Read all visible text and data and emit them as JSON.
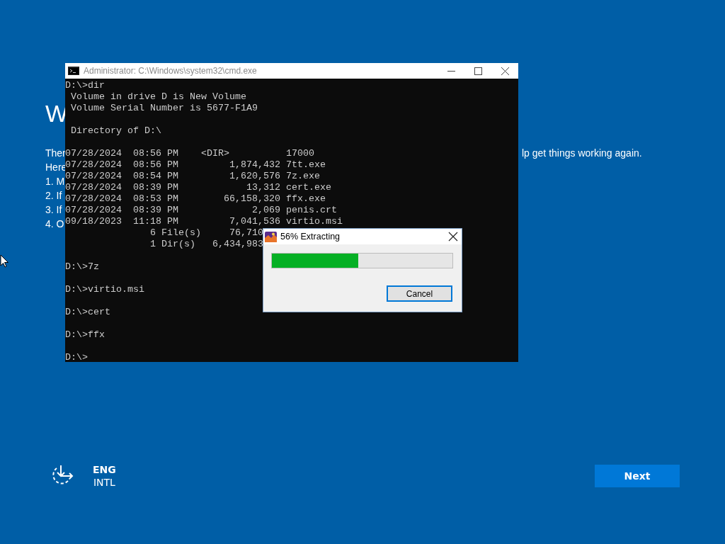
{
  "background_page": {
    "heading": "W",
    "lines": [
      "Ther",
      "Here",
      "1. M",
      "2. If",
      "3. If",
      "4. O"
    ],
    "line_end": "lp get things working again."
  },
  "cmd_window": {
    "title": "Administrator: C:\\Windows\\system32\\cmd.exe",
    "blocks": [
      [
        "D:\\>dir",
        " Volume in drive D is New Volume",
        " Volume Serial Number is 5677-F1A9"
      ],
      [
        " Directory of D:\\"
      ],
      [
        "07/28/2024  08:56 PM    <DIR>          17000",
        "07/28/2024  08:56 PM         1,874,432 7tt.exe",
        "07/28/2024  08:54 PM         1,620,576 7z.exe",
        "07/28/2024  08:39 PM            13,312 cert.exe",
        "07/28/2024  08:53 PM        66,158,320 ffx.exe",
        "07/28/2024  08:39 PM             2,069 penis.crt",
        "09/18/2023  11:18 PM         7,041,536 virtio.msi",
        "               6 File(s)     76,710",
        "               1 Dir(s)   6,434,983"
      ],
      [
        "D:\\>7z"
      ],
      [
        "D:\\>virtio.msi"
      ],
      [
        "D:\\>cert"
      ],
      [
        "D:\\>ffx"
      ],
      [
        "D:\\>"
      ]
    ]
  },
  "progress_dialog": {
    "title": "56% Extracting",
    "progress": {
      "level": 0.48
    },
    "button": "Cancel"
  },
  "language": {
    "code": "ENG",
    "layout": "INTL"
  },
  "next_button": "Next"
}
